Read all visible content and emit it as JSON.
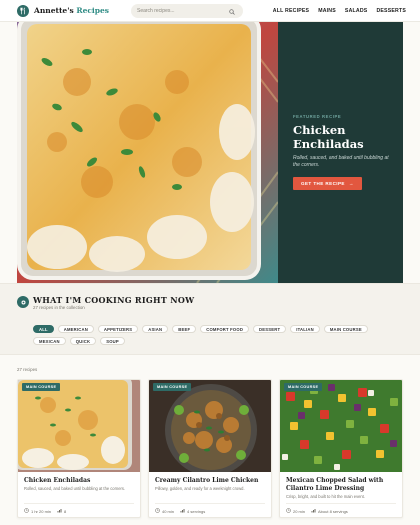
{
  "brand": {
    "name_main": "Annette's",
    "name_accent": "Recipes",
    "logo_icon": "whisk-icon",
    "color": "#2e6b66"
  },
  "search": {
    "placeholder": "Search recipes..."
  },
  "nav": [
    {
      "label": "ALL RECIPES"
    },
    {
      "label": "MAINS"
    },
    {
      "label": "SALADS"
    },
    {
      "label": "DESSERTS"
    }
  ],
  "hero": {
    "featured_label": "FEATURED RECIPE",
    "title": "Chicken Enchiladas",
    "description": "Rolled, sauced, and baked until bubbling at the corners.",
    "button_label": "GET THE RECIPE",
    "button_arrow": "→",
    "panel_color": "#1f3a37",
    "button_color": "#e2573f"
  },
  "cooking": {
    "title": "WHAT I'M COOKING RIGHT NOW",
    "subtitle": "27 recipes in the collection",
    "chips": [
      {
        "label": "ALL",
        "active": true
      },
      {
        "label": "AMERICAN"
      },
      {
        "label": "APPETIZERS"
      },
      {
        "label": "ASIAN"
      },
      {
        "label": "BEEF"
      },
      {
        "label": "COMFORT FOOD"
      },
      {
        "label": "DESSERT"
      },
      {
        "label": "ITALIAN"
      },
      {
        "label": "MAIN COURSE"
      },
      {
        "label": "MEXICAN"
      },
      {
        "label": "QUICK"
      },
      {
        "label": "SOUP"
      }
    ]
  },
  "recipes": {
    "count": "27 recipes",
    "cards": [
      {
        "badge": "MAIN COURSE",
        "title": "Chicken Enchiladas",
        "description": "Rolled, sauced, and baked until bubbling at the corners.",
        "time": "1 hr 20 min",
        "servings": "8"
      },
      {
        "badge": "MAIN COURSE",
        "title": "Creamy Cilantro Lime Chicken",
        "description": "Pillowy, golden, and ready for a weeknight crowd.",
        "time": "40 min",
        "servings": "4 servings"
      },
      {
        "badge": "MAIN COURSE",
        "title": "Mexican Chopped Salad with Cilantro Lime Dressing",
        "description": "Crisp, bright, and built to hit the main event.",
        "time": "20 min",
        "servings": "About 8 servings"
      }
    ]
  }
}
